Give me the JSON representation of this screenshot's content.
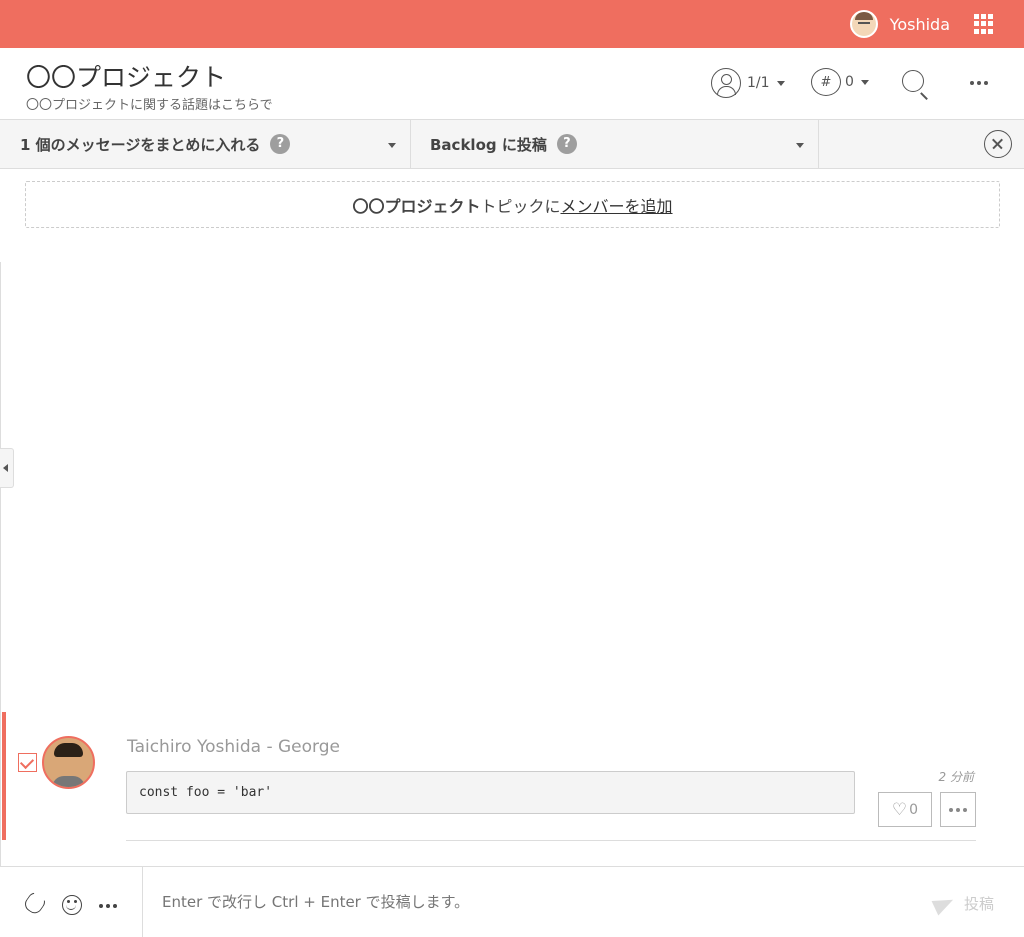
{
  "topbar": {
    "user_name": "Yoshida",
    "avatar_icon": "user-avatar",
    "apps_icon": "grid-icon",
    "bg_color": "#ef6e5f"
  },
  "header": {
    "title": "〇〇プロジェクト",
    "subtitle": "〇〇プロジェクトに関する話題はこちらで",
    "members_count": "1/1",
    "hashtag_symbol": "#",
    "topics_count": "0"
  },
  "toolbar": {
    "combine_label": "1 個のメッセージをまとめに入れる",
    "post_label": "Backlog に投稿",
    "help_symbol": "?"
  },
  "notice": {
    "topic_name": "〇〇プロジェクト",
    "middle_text": "トピックに",
    "link_text": "メンバーを追加"
  },
  "message": {
    "author": "Taichiro Yoshida - George",
    "code": "const foo = 'bar'",
    "time": "2 分前",
    "like_count": "0",
    "accent_color": "#ef6e5f"
  },
  "composer": {
    "placeholder": "Enter で改行し Ctrl + Enter で投稿します。",
    "post_button": "投稿"
  }
}
